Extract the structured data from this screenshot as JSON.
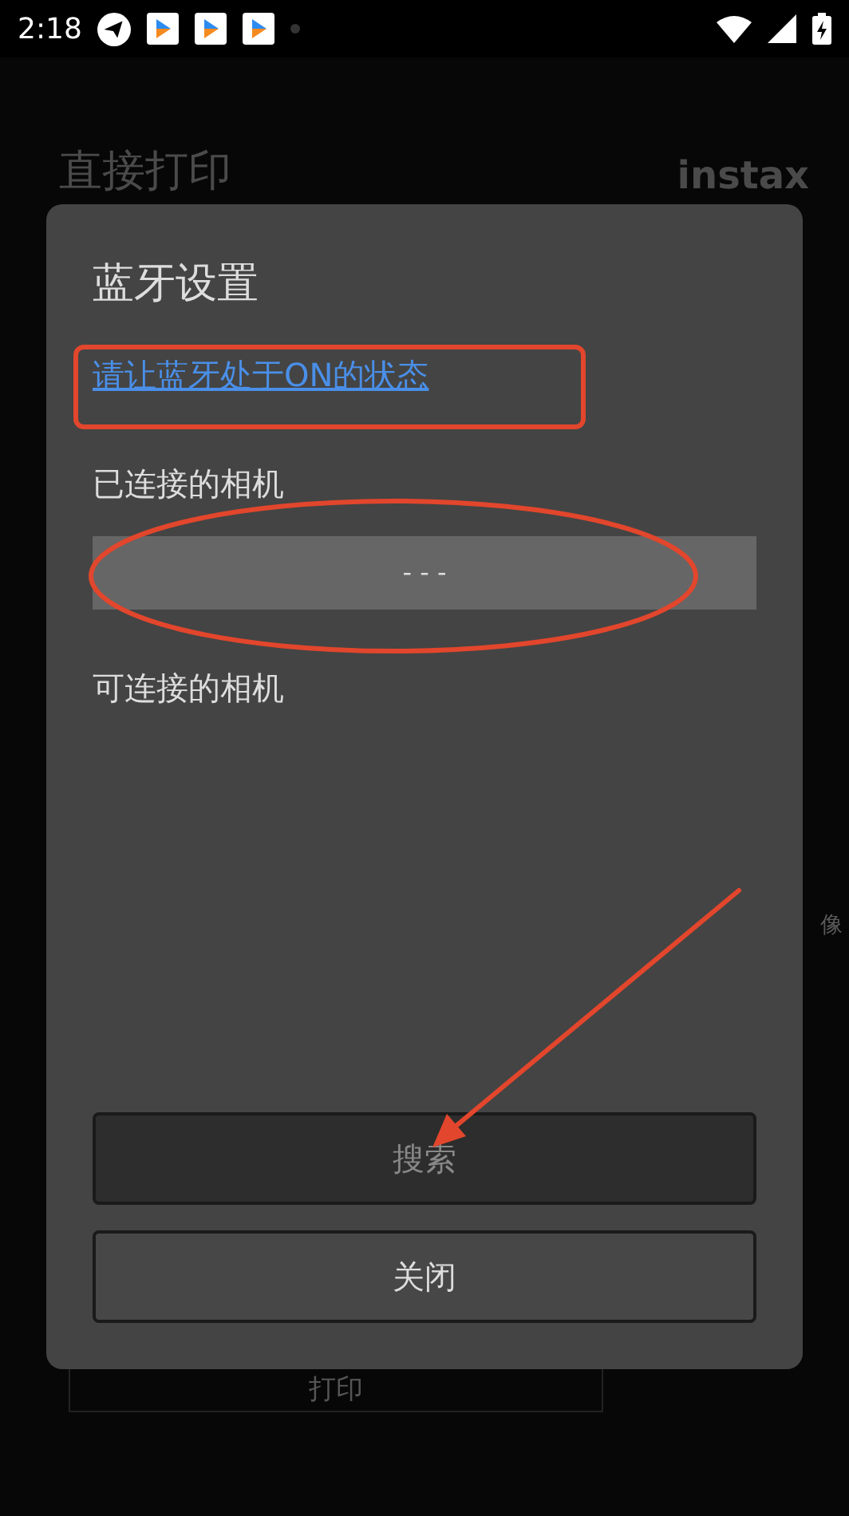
{
  "status_bar": {
    "time": "2:18"
  },
  "background": {
    "title": "直接打印",
    "logo": "instax",
    "side_text": "像",
    "print_button": "打印"
  },
  "dialog": {
    "title": "蓝牙设置",
    "link": "请让蓝牙处于ON的状态",
    "connected_label": "已连接的相机",
    "connected_value": "- - -",
    "available_label": "可连接的相机",
    "buttons": [
      {
        "label": "搜索",
        "disabled": true
      },
      {
        "label": "关闭",
        "disabled": false
      }
    ]
  }
}
